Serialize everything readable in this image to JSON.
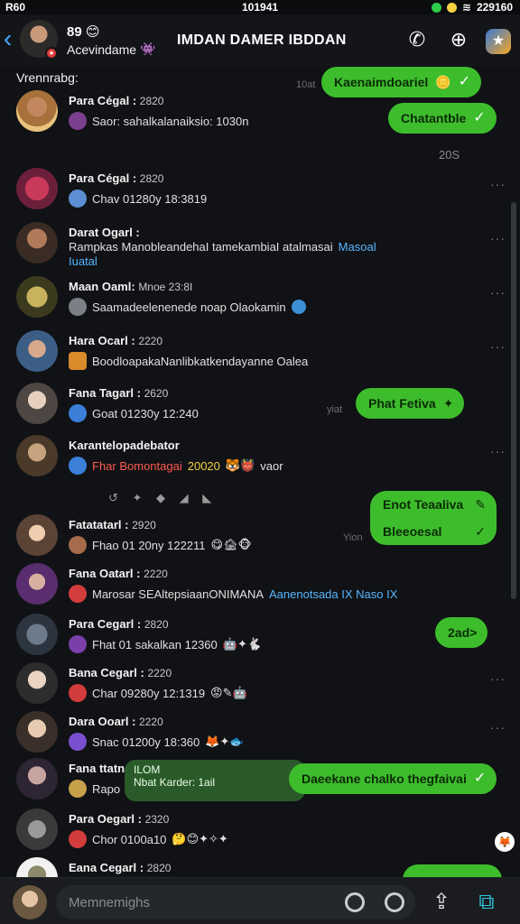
{
  "status_bar": {
    "carrier": "R60",
    "time": "101941",
    "battery": "229160"
  },
  "header": {
    "contact_name": "89",
    "contact_status": "Acevindame",
    "title": "IMDAN DAMER IBDDAN",
    "back_icon": "chevron-left-icon",
    "call_icon": "phone-icon",
    "add_icon": "add-chat-icon"
  },
  "chat": {
    "section_label": "Vrennrabg:",
    "rows": [
      {
        "name": "Para Cégal :",
        "time": "2820",
        "preview": "Saor: sahalkalanaiksio: 1030n"
      },
      {
        "name": "Para Cégal :",
        "time": "2820",
        "preview": "Chav 01280y 18:3819"
      },
      {
        "name": "Darat Ogarl :",
        "time": "",
        "preview": "Rampkas ManobleandehaI tamekambiaI atalmasai",
        "preview_highlight": "Masoal",
        "preview_line2": "Iuatal"
      },
      {
        "name": "Maan Oaml:",
        "time": "Mnoe 23:8I",
        "preview": "Saamadeelenenede noap Olaokamin"
      },
      {
        "name": "Hara Ocarl :",
        "time": "2220",
        "preview": "BoodloapakaNanlibkatkendayanne Oalea"
      },
      {
        "name": "Fana Tagarl :",
        "time": "2620",
        "preview": "Goat 01230y 12:240"
      },
      {
        "name": "Karantelopadebator",
        "time": "",
        "preview_red": "Fhar Bomontagai",
        "preview_yellow": "20020",
        "preview_tail": "vaor"
      },
      {
        "name": "Fatatatarl :",
        "time": "2920",
        "preview": "Fhao 01 20ny 122211"
      },
      {
        "name": "Fana Oatarl :",
        "time": "2220",
        "preview": "Marosar SEAltepsiaanONIMANA",
        "preview_highlight": "Aanenotsada IX Naso IX"
      },
      {
        "name": "Para Cegarl :",
        "time": "2820",
        "preview": "Fhat 01 sakalkan 12360"
      },
      {
        "name": "Bana Cegarl :",
        "time": "2220",
        "preview": "Char 09280y 12:1319"
      },
      {
        "name": "Dara Ooarl :",
        "time": "2220",
        "preview": "Snac 01200y 18:360"
      },
      {
        "name": "Fana ttatn",
        "time": "",
        "preview": "Rapo"
      },
      {
        "name": "Para Oegarl :",
        "time": "2320",
        "preview": "Chor 0100a10"
      },
      {
        "name": "Eana Cegarl :",
        "time": "2820",
        "preview": ""
      }
    ],
    "bubbles": {
      "b1": "Kaenaimdoariel",
      "b2": "Chatantble",
      "b3": "Phat Fetiva",
      "stack_line1": "Enot Teaaliva",
      "stack_line2": "Bleeoesal",
      "b5": "2ad>",
      "b6": "Daeekane chalko thegfaivai"
    },
    "reply_card": {
      "title": "ILOM",
      "text": "Nbat Karder: 1ail"
    },
    "ghost_times": {
      "g1": "10at",
      "g2": "20S",
      "g3": "yiat",
      "g4": "Yion"
    }
  },
  "compose": {
    "placeholder": "Memnemighs",
    "send_icon": "send-image-icon",
    "share_icon": "share-icon"
  },
  "colors": {
    "bubble_green": "#3dbd2c",
    "background": "#101215",
    "accent_blue": "#4aa8ff"
  }
}
